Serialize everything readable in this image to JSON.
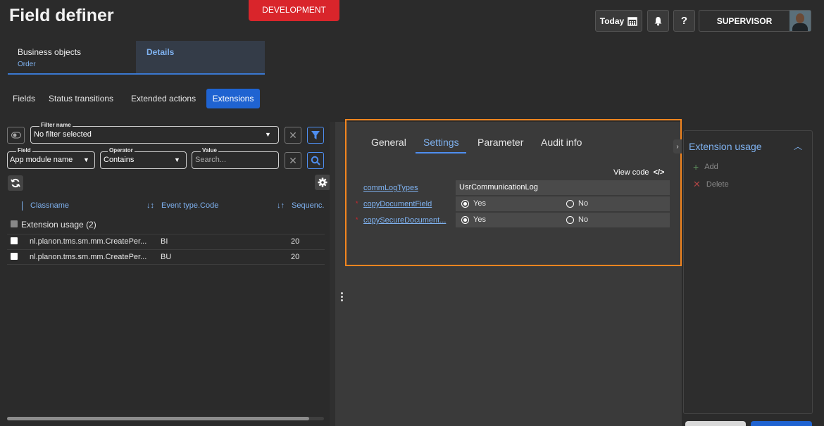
{
  "header": {
    "title": "Field definer",
    "environment": "DEVELOPMENT",
    "today_label": "Today",
    "help_label": "?",
    "user_name": "SUPERVISOR"
  },
  "top_tabs": [
    {
      "title": "Business objects",
      "subtitle": "Order"
    },
    {
      "title": "Details",
      "subtitle": ""
    }
  ],
  "sub_tabs": [
    "Fields",
    "Status transitions",
    "Extended actions",
    "Extensions"
  ],
  "filter": {
    "filter_name_label": "Filter name",
    "filter_name_value": "No filter selected",
    "field_label": "Field",
    "field_value": "App module name",
    "operator_label": "Operator",
    "operator_value": "Contains",
    "value_label": "Value",
    "value_placeholder": "Search..."
  },
  "table": {
    "columns": [
      "Classname",
      "Event type.Code",
      "Sequenc."
    ],
    "group_label": "Extension usage (2)",
    "rows": [
      {
        "classname": "nl.planon.tms.sm.mm.CreatePer...",
        "event": "BI",
        "sequence": "20"
      },
      {
        "classname": "nl.planon.tms.sm.mm.CreatePer...",
        "event": "BU",
        "sequence": "20"
      }
    ]
  },
  "detail_tabs": [
    "General",
    "Settings",
    "Parameter",
    "Audit info"
  ],
  "view_code_label": "View code",
  "view_code_icon": "</>",
  "settings": [
    {
      "name": "commLogTypes",
      "value": "UsrCommunicationLog",
      "required": false
    },
    {
      "name": "copyDocumentField",
      "yes": "Yes",
      "no": "No",
      "required": true
    },
    {
      "name": "copySecureDocument...",
      "yes": "Yes",
      "no": "No",
      "required": true
    }
  ],
  "usage_panel": {
    "title": "Extension usage",
    "add_label": "Add",
    "delete_label": "Delete"
  },
  "colors": {
    "accent": "#1f63d1",
    "link": "#7fb2f0",
    "highlight": "#f2851f",
    "env": "#d9252b"
  }
}
